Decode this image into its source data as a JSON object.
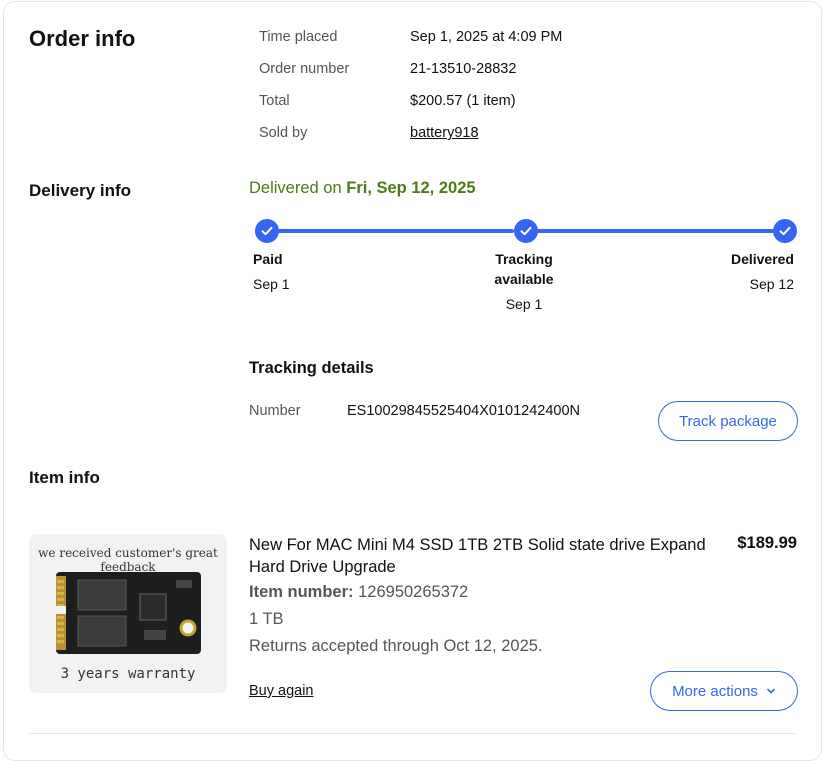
{
  "order_info": {
    "heading": "Order info",
    "rows": [
      {
        "label": "Time placed",
        "value": "Sep 1, 2025 at 4:09 PM"
      },
      {
        "label": "Order number",
        "value": "21-13510-28832"
      },
      {
        "label": "Total",
        "value": "$200.57 (1 item)"
      },
      {
        "label": "Sold by",
        "value": "battery918"
      }
    ]
  },
  "delivery_info": {
    "heading": "Delivery info",
    "status_prefix": "Delivered on ",
    "status_date": "Fri, Sep 12, 2025",
    "steps": [
      {
        "label": "Paid",
        "date": "Sep 1"
      },
      {
        "label": "Tracking available",
        "label_line1": "Tracking",
        "label_line2": "available",
        "date": "Sep 1"
      },
      {
        "label": "Delivered",
        "date": "Sep 12"
      }
    ],
    "tracking_heading": "Tracking details",
    "tracking_number_label": "Number",
    "tracking_number": "ES10029845525404X0101242400N",
    "track_button": "Track package"
  },
  "item_info": {
    "heading": "Item info",
    "image_caption_top": "we received customer's great feedback",
    "image_caption_bottom": "3 years warranty",
    "title": "New For MAC Mini M4 SSD 1TB 2TB Solid state drive Expand Hard Drive Upgrade",
    "price": "$189.99",
    "item_number_label": "Item number:",
    "item_number": "126950265372",
    "variant": "1 TB",
    "returns": "Returns accepted through Oct 12, 2025.",
    "buy_again": "Buy again",
    "more_actions": "More actions"
  },
  "colors": {
    "accent": "#3665f3",
    "delivered_green": "#4d7a19"
  },
  "icons": {
    "step_check": "check-icon",
    "dropdown": "chevron-down-icon"
  }
}
